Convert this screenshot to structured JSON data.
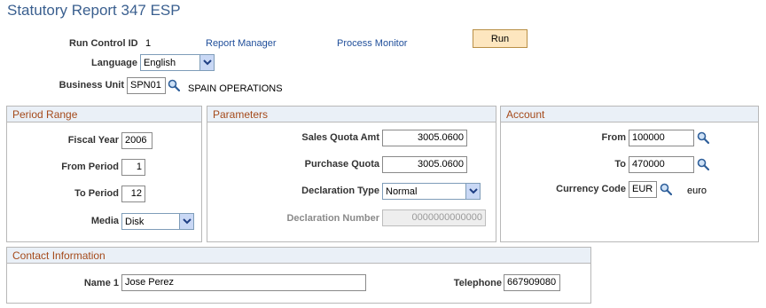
{
  "page": {
    "title": "Statutory Report 347 ESP"
  },
  "header": {
    "run_control_label": "Run Control ID",
    "run_control_value": "1",
    "report_manager_link": "Report Manager",
    "process_monitor_link": "Process Monitor",
    "run_button": "Run",
    "language_label": "Language",
    "language_value": "English",
    "business_unit_label": "Business Unit",
    "business_unit_value": "SPN01",
    "business_unit_desc": "SPAIN OPERATIONS"
  },
  "period_range": {
    "title": "Period Range",
    "fiscal_year_label": "Fiscal Year",
    "fiscal_year_value": "2006",
    "from_period_label": "From Period",
    "from_period_value": "1",
    "to_period_label": "To Period",
    "to_period_value": "12",
    "media_label": "Media",
    "media_value": "Disk"
  },
  "parameters": {
    "title": "Parameters",
    "sales_quota_label": "Sales Quota Amt",
    "sales_quota_value": "3005.0600",
    "purchase_quota_label": "Purchase Quota",
    "purchase_quota_value": "3005.0600",
    "declaration_type_label": "Declaration Type",
    "declaration_type_value": "Normal",
    "declaration_number_label": "Declaration Number",
    "declaration_number_value": "0000000000000"
  },
  "account": {
    "title": "Account",
    "from_label": "From",
    "from_value": "100000",
    "to_label": "To",
    "to_value": "470000",
    "currency_label": "Currency Code",
    "currency_value": "EUR",
    "currency_desc": "euro"
  },
  "contact": {
    "title": "Contact Information",
    "name_label": "Name 1",
    "name_value": "Jose Perez",
    "telephone_label": "Telephone",
    "telephone_value": "667909080"
  },
  "colors": {
    "title": "#3a5f8f",
    "group_header_text": "#a54a1b",
    "group_header_bg": "#eaf0f7",
    "link": "#1f4e9a",
    "button_bg": "#fde6bf"
  },
  "icons": {
    "lookup": "magnifier-icon",
    "dropdown": "chevron-down-icon"
  }
}
